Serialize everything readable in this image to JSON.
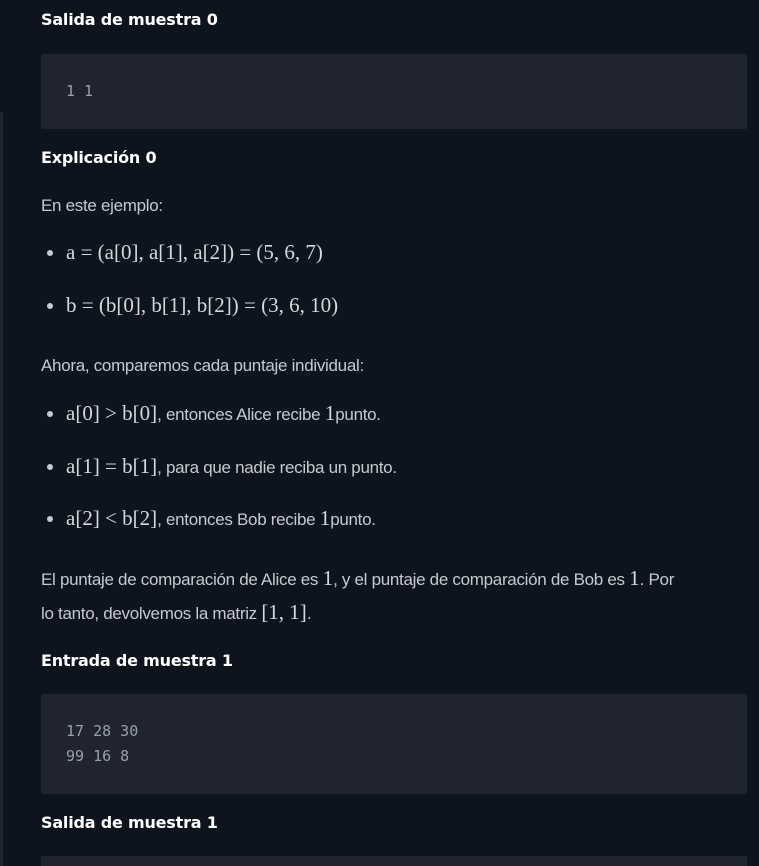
{
  "sample_output_0": {
    "title": "Salida de muestra 0",
    "lines": [
      "1 1"
    ]
  },
  "explanation_0": {
    "title": "Explicación 0",
    "intro": "En este ejemplo:",
    "bullets_vectors": [
      {
        "expr": "a = (a[0], a[1], a[2]) = (5, 6, 7)"
      },
      {
        "expr": "b = (b[0], b[1], b[2]) = (3, 6, 10)"
      }
    ],
    "compare_intro": "Ahora, comparemos cada puntaje individual:",
    "bullets_compare": [
      {
        "expr": "a[0] > b[0]",
        "text": ", entonces Alice recibe ",
        "num": "1",
        "suffix": "punto."
      },
      {
        "expr": "a[1] = b[1]",
        "text": ", para que nadie reciba un punto.",
        "num": "",
        "suffix": ""
      },
      {
        "expr": "a[2] < b[2]",
        "text": ", entonces Bob recibe ",
        "num": "1",
        "suffix": "punto."
      }
    ],
    "conclusion_line1_a": "El puntaje de comparación de Alice es ",
    "conclusion_num_1": "1",
    "conclusion_line1_b": ", y el puntaje de comparación de Bob es ",
    "conclusion_num_2": "1",
    "conclusion_line1_c": ". Por",
    "conclusion_line2_a": "lo tanto, devolvemos la matriz ",
    "conclusion_matrix": "[1, 1]",
    "conclusion_line2_b": "."
  },
  "sample_input_1": {
    "title": "Entrada de muestra 1",
    "lines": [
      "17 28 30",
      "99 16 8"
    ]
  },
  "sample_output_1": {
    "title": "Salida de muestra 1"
  }
}
